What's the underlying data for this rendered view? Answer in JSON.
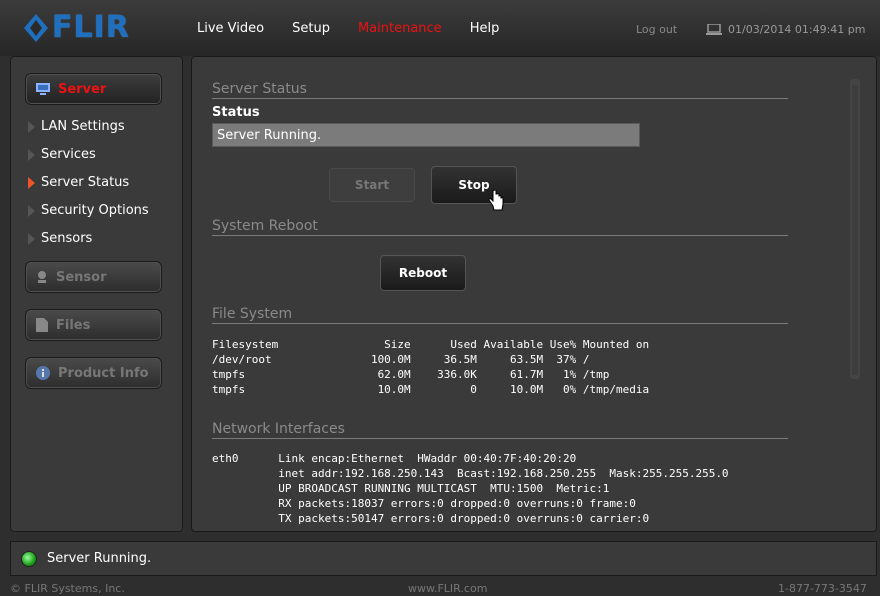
{
  "brand": {
    "logo_text": "FLIR"
  },
  "nav": {
    "items": [
      {
        "label": "Live Video",
        "active": false
      },
      {
        "label": "Setup",
        "active": false
      },
      {
        "label": "Maintenance",
        "active": true
      },
      {
        "label": "Help",
        "active": false
      }
    ]
  },
  "header": {
    "logout": "Log out",
    "datetime": "01/03/2014 01:49:41 pm"
  },
  "sidebar": {
    "server_button": "Server",
    "items": [
      {
        "label": "LAN Settings",
        "active": false
      },
      {
        "label": "Services",
        "active": false
      },
      {
        "label": "Server Status",
        "active": true
      },
      {
        "label": "Security Options",
        "active": false
      },
      {
        "label": "Sensors",
        "active": false
      }
    ],
    "sensor_button": "Sensor",
    "files_button": "Files",
    "product_info_button": "Product Info"
  },
  "main": {
    "server_status_title": "Server Status",
    "status_label": "Status",
    "status_value": "Server Running.",
    "start_label": "Start",
    "stop_label": "Stop",
    "system_reboot_title": "System Reboot",
    "reboot_label": "Reboot",
    "file_system_title": "File System",
    "file_system_text": "Filesystem                Size      Used Available Use% Mounted on\n/dev/root               100.0M     36.5M     63.5M  37% /\ntmpfs                    62.0M    336.0K     61.7M   1% /tmp\ntmpfs                    10.0M         0     10.0M   0% /tmp/media",
    "network_title": "Network Interfaces",
    "network_text": "eth0      Link encap:Ethernet  HWaddr 00:40:7F:40:20:20\n          inet addr:192.168.250.143  Bcast:192.168.250.255  Mask:255.255.255.0\n          UP BROADCAST RUNNING MULTICAST  MTU:1500  Metric:1\n          RX packets:18037 errors:0 dropped:0 overruns:0 frame:0\n          TX packets:50147 errors:0 dropped:0 overruns:0 carrier:0"
  },
  "statusbar": {
    "text": "Server Running."
  },
  "footer": {
    "copyright": "© FLIR Systems, Inc.",
    "website": "www.FLIR.com",
    "phone": "1-877-773-3547"
  },
  "colors": {
    "active": "#ee1111",
    "led": "#1a9e1a",
    "brand": "#1f6fbf"
  }
}
